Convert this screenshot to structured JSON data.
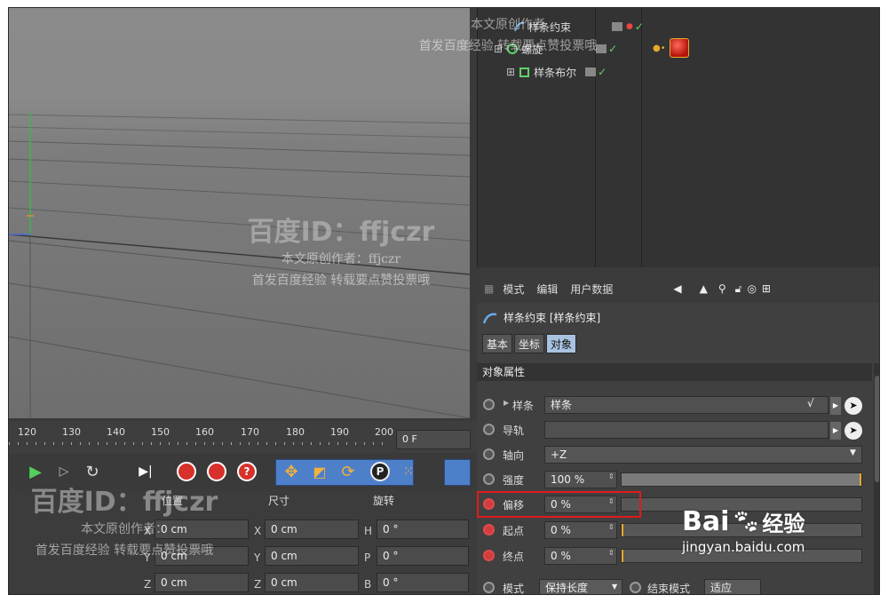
{
  "object_manager": {
    "rows": [
      {
        "label": "样条约束",
        "color": "#f2c44c"
      },
      {
        "label": "螺旋",
        "color": "#ddd"
      },
      {
        "label": "样条布尔",
        "color": "#ddd"
      }
    ]
  },
  "attribute_manager": {
    "menu": [
      "模式",
      "编辑",
      "用户数据"
    ],
    "title": "样条约束 [样条约束]",
    "tabs": [
      "基本",
      "坐标",
      "对象"
    ],
    "active_tab": "对象",
    "section": "对象属性",
    "props": [
      {
        "label": "样条",
        "value": "样条"
      },
      {
        "label": "导轨",
        "value": ""
      },
      {
        "label": "轴向",
        "value": "+Z"
      },
      {
        "label": "强度",
        "value": "100 %"
      },
      {
        "label": "偏移",
        "value": "0 %"
      },
      {
        "label": "起点",
        "value": "0 %"
      },
      {
        "label": "终点",
        "value": "0 %"
      }
    ],
    "mode_label": "模式",
    "mode_value": "保持长度",
    "end_mode_label": "结束模式",
    "end_mode_value": "适应"
  },
  "timeline": {
    "ticks": [
      "120",
      "130",
      "140",
      "150",
      "160",
      "170",
      "180",
      "190",
      "200"
    ],
    "current_frame": "0 F"
  },
  "coordinates": {
    "headers": [
      "位置",
      "尺寸",
      "旋转"
    ],
    "position": [
      {
        "axis": "X",
        "value": "0 cm"
      },
      {
        "axis": "Y",
        "value": "0 cm"
      },
      {
        "axis": "Z",
        "value": "0 cm"
      }
    ],
    "size": [
      {
        "axis": "X",
        "value": "0 cm"
      },
      {
        "axis": "Y",
        "value": "0 cm"
      },
      {
        "axis": "Z",
        "value": "0 cm"
      }
    ],
    "rotation": [
      {
        "axis": "H",
        "value": "0 °"
      },
      {
        "axis": "P",
        "value": "0 °"
      },
      {
        "axis": "B",
        "value": "0 °"
      }
    ]
  },
  "watermarks": {
    "id_text": "百度ID：ffjczr",
    "line1": "本文原创作者：ffjczr",
    "line2": "首发百度经验 转载要点赞投票哦",
    "line1_top": "本文原创作者",
    "line2_top": "首发百度经验 转载要点赞投票哦",
    "line1_bottom": "本文原创作者：",
    "line2_bottom": "首发百度经验 转载要点赞投票哦",
    "baidu_logo": "Bai",
    "baidu_logo_tail": "经验",
    "baidu_url": "jingyan.baidu.com"
  },
  "colors": {
    "highlight": "#e01b1b",
    "active_tab": "#a9c2e0",
    "accent_orange": "#e8a92a"
  }
}
